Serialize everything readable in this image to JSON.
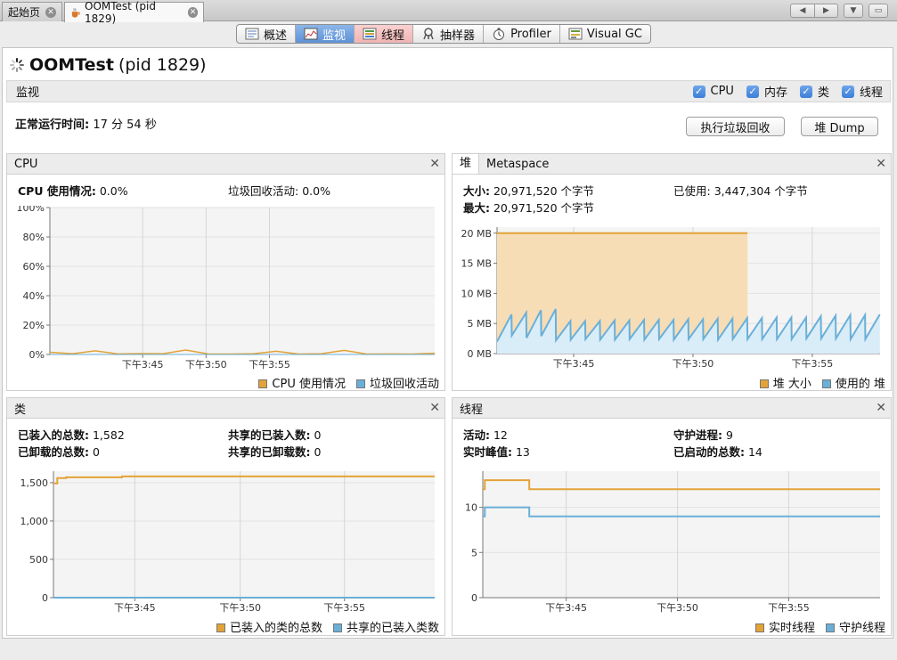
{
  "window": {
    "tabs": [
      {
        "label": "起始页"
      },
      {
        "label": "OOMTest (pid 1829)"
      }
    ]
  },
  "view_tabs": [
    {
      "label": "概述"
    },
    {
      "label": "监视"
    },
    {
      "label": "线程"
    },
    {
      "label": "抽样器"
    },
    {
      "label": "Profiler"
    },
    {
      "label": "Visual GC"
    }
  ],
  "app": {
    "title_name": "OOMTest",
    "title_pid": "(pid 1829)"
  },
  "monitor": {
    "label": "监视",
    "checkboxes": [
      {
        "label": "CPU"
      },
      {
        "label": "内存"
      },
      {
        "label": "类"
      },
      {
        "label": "线程"
      }
    ],
    "uptime_label": "正常运行时间:",
    "uptime_value": "17 分 54 秒",
    "gc_button": "执行垃圾回收",
    "dump_button": "堆 Dump"
  },
  "cpu_panel": {
    "title": "CPU",
    "usage_label": "CPU 使用情况:",
    "usage_value": "0.0%",
    "gc_label": "垃圾回收活动:",
    "gc_value": "0.0%",
    "legend": [
      "CPU 使用情况",
      "垃圾回收活动"
    ]
  },
  "heap_panel": {
    "tabs": [
      "堆",
      "Metaspace"
    ],
    "size_label": "大小:",
    "size_value": "20,971,520 个字节",
    "used_label": "已使用:",
    "used_value": "3,447,304 个字节",
    "max_label": "最大:",
    "max_value": "20,971,520 个字节",
    "legend": [
      "堆 大小",
      "使用的 堆"
    ]
  },
  "class_panel": {
    "title": "类",
    "loaded_label": "已装入的总数:",
    "loaded_value": "1,582",
    "unloaded_label": "已卸载的总数:",
    "unloaded_value": "0",
    "shared_loaded_label": "共享的已装入数:",
    "shared_loaded_value": "0",
    "shared_unloaded_label": "共享的已卸载数:",
    "shared_unloaded_value": "0",
    "legend": [
      "已装入的类的总数",
      "共享的已装入类数"
    ]
  },
  "thread_panel": {
    "title": "线程",
    "live_label": "活动:",
    "live_value": "12",
    "daemon_label": "守护进程:",
    "daemon_value": "9",
    "peak_label": "实时峰值:",
    "peak_value": "13",
    "started_label": "已启动的总数:",
    "started_value": "14",
    "legend": [
      "实时线程",
      "守护线程"
    ]
  },
  "colors": {
    "orange": "#e3a337",
    "blue": "#6aafd8",
    "accent": "#5e91d6"
  },
  "chart_data": [
    {
      "id": "cpu",
      "type": "area",
      "xticks": [
        "下午3:45",
        "下午3:50",
        "下午3:55"
      ],
      "yticks": [
        "0%",
        "20%",
        "40%",
        "60%",
        "80%",
        "100%"
      ],
      "ylim": [
        0,
        100
      ],
      "series": [
        {
          "name": "CPU 使用情况",
          "x": [
            0,
            1,
            2,
            3,
            4,
            5,
            6,
            7,
            8,
            9,
            10,
            11,
            12,
            13,
            14,
            15,
            16,
            17
          ],
          "y": [
            1.5,
            0.5,
            2.5,
            0.4,
            0.6,
            0.5,
            3,
            0.4,
            0.3,
            0.5,
            2.2,
            0.3,
            0.5,
            2.8,
            0.3,
            0.4,
            0.3,
            0.8
          ]
        },
        {
          "name": "垃圾回收活动",
          "x": [
            0,
            17
          ],
          "y": [
            0,
            0
          ]
        }
      ]
    },
    {
      "id": "heap",
      "type": "area",
      "xticks": [
        "下午3:45",
        "下午3:50",
        "下午3:55"
      ],
      "yticks": [
        "0 MB",
        "5 MB",
        "10 MB",
        "15 MB",
        "20 MB"
      ],
      "ylim": [
        0,
        21
      ],
      "series": [
        {
          "name": "堆 大小",
          "x": [
            0,
            17
          ],
          "y": [
            20,
            20
          ]
        },
        {
          "name": "使用的 堆",
          "sawtooth": [
            [
              2,
              6.5
            ],
            [
              3,
              6.8
            ],
            [
              2.6,
              7.2
            ],
            [
              2.9,
              7.4
            ],
            [
              2.2,
              5.4
            ],
            [
              2.3,
              5.4
            ],
            [
              2.4,
              5.4
            ],
            [
              2.3,
              5.5
            ],
            [
              2.3,
              5.5
            ],
            [
              2.4,
              5.6
            ],
            [
              2.3,
              5.6
            ],
            [
              2.4,
              5.6
            ],
            [
              2.3,
              5.7
            ],
            [
              2.4,
              5.7
            ],
            [
              2.4,
              5.8
            ],
            [
              2.3,
              5.8
            ],
            [
              2.4,
              5.9
            ],
            [
              2.4,
              5.9
            ],
            [
              2.4,
              6
            ],
            [
              2.4,
              6
            ],
            [
              2.4,
              6
            ],
            [
              2.5,
              6.2
            ],
            [
              2.5,
              6.3
            ],
            [
              2.5,
              6.4
            ],
            [
              2.4,
              6.4
            ],
            [
              2.4,
              6.5
            ]
          ]
        }
      ]
    },
    {
      "id": "classes",
      "type": "line",
      "xticks": [
        "下午3:45",
        "下午3:50",
        "下午3:55"
      ],
      "yticks": [
        "0",
        "500",
        "1,000",
        "1,500"
      ],
      "ylim": [
        0,
        1650
      ],
      "series": [
        {
          "name": "已装入的类的总数",
          "x": [
            0,
            0.3,
            1,
            5.3,
            5.4,
            30
          ],
          "y": [
            1490,
            1560,
            1570,
            1570,
            1582,
            1582
          ]
        },
        {
          "name": "共享的已装入类数",
          "x": [
            0,
            30
          ],
          "y": [
            0,
            0
          ]
        }
      ]
    },
    {
      "id": "threads",
      "type": "line",
      "xticks": [
        "下午3:45",
        "下午3:50",
        "下午3:55"
      ],
      "yticks": [
        "0",
        "5",
        "10"
      ],
      "ylim": [
        0,
        14
      ],
      "series": [
        {
          "name": "实时线程",
          "x": [
            0,
            0.15,
            0.3,
            3.5,
            3.51,
            30
          ],
          "y": [
            12,
            13,
            13,
            13,
            12,
            12
          ]
        },
        {
          "name": "守护线程",
          "x": [
            0,
            0.15,
            0.3,
            3.5,
            3.51,
            30
          ],
          "y": [
            9,
            10,
            10,
            10,
            9,
            9
          ]
        }
      ]
    }
  ]
}
